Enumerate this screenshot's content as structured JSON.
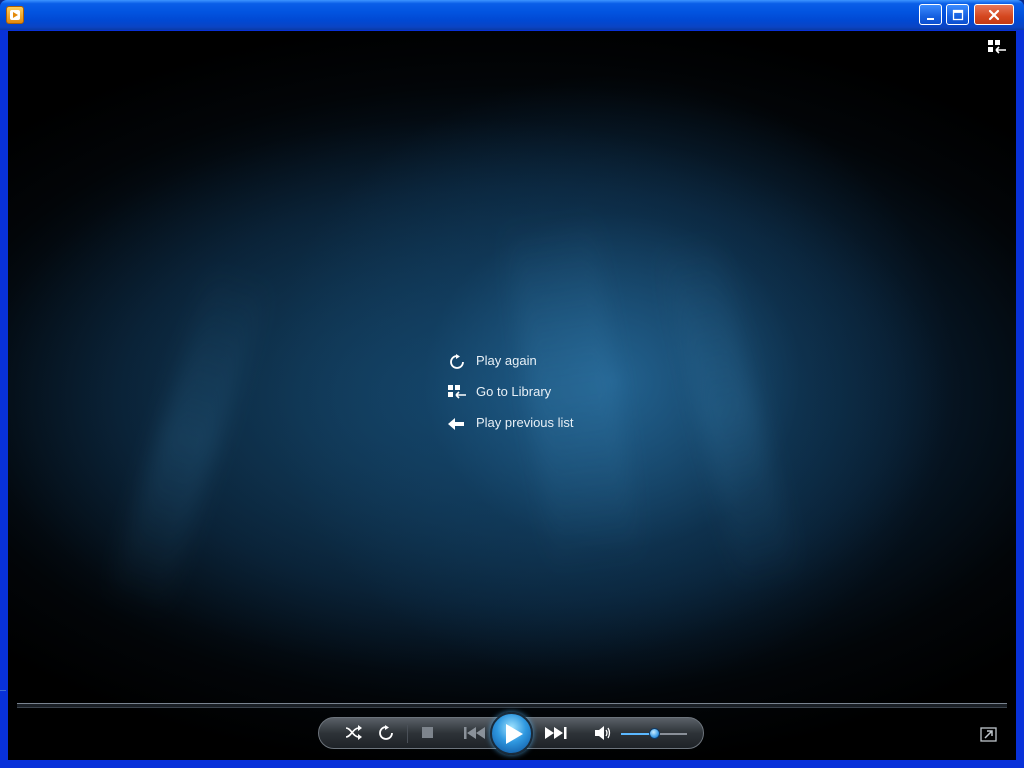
{
  "window": {
    "title": "",
    "controls": {
      "minimize": "minimize",
      "maximize": "maximize",
      "close": "close"
    }
  },
  "overlay_menu": {
    "items": [
      {
        "label": "Play again",
        "icon": "replay-icon"
      },
      {
        "label": "Go to Library",
        "icon": "library-icon"
      },
      {
        "label": "Play previous list",
        "icon": "back-arrow-icon"
      }
    ]
  },
  "toolbar": {
    "top_right": {
      "icon": "switch-to-library-icon"
    },
    "controls": [
      {
        "name": "shuffle-button",
        "icon": "shuffle-icon"
      },
      {
        "name": "repeat-button",
        "icon": "repeat-icon"
      },
      {
        "name": "stop-button",
        "icon": "stop-icon"
      },
      {
        "name": "previous-button",
        "icon": "previous-icon"
      },
      {
        "name": "play-button",
        "icon": "play-icon"
      },
      {
        "name": "next-button",
        "icon": "next-icon"
      },
      {
        "name": "mute-button",
        "icon": "speaker-icon"
      }
    ],
    "volume_level": 0.5,
    "bottom_right": {
      "icon": "switch-to-now-playing-icon"
    }
  },
  "colors": {
    "accent": "#3fa0ff",
    "titlebar": "#0254e0",
    "close": "#d5471f",
    "menu_text": "#e8f0f6"
  }
}
